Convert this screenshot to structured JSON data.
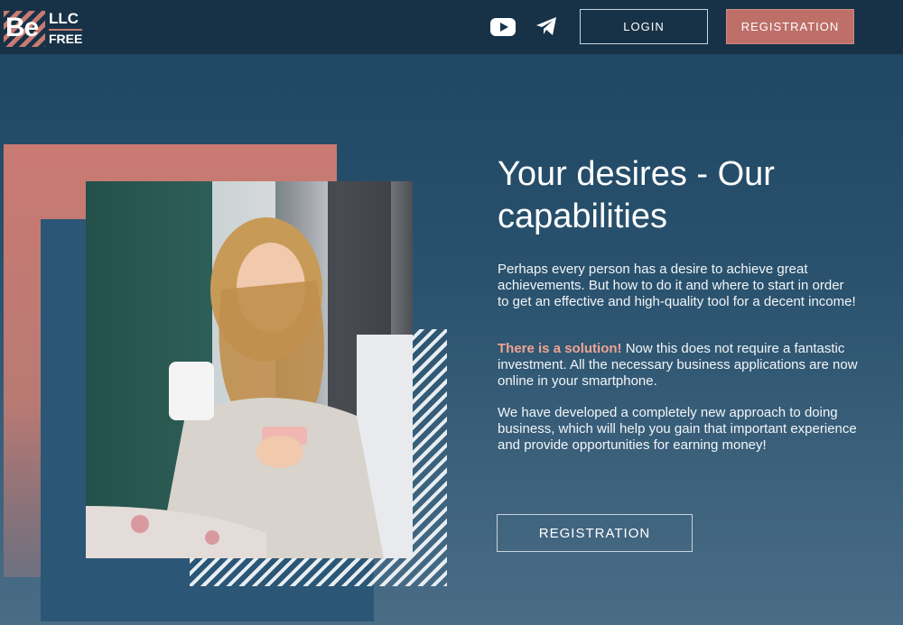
{
  "header": {
    "logo": {
      "main": "Be",
      "top": "LLC",
      "bottom": "FREE"
    },
    "icons": [
      "youtube-icon",
      "telegram-icon"
    ],
    "login_label": "LOGIN",
    "registration_label": "REGISTRATION"
  },
  "hero": {
    "title": "Your desires - Our capabilities",
    "paragraph1": "Perhaps every person has a desire to achieve great achievements. But how to do it and where to start in order to get an effective and high-quality tool for a decent income!",
    "paragraph2_highlight": "There is a solution!",
    "paragraph2_rest": " Now this does not require a fantastic investment. All the necessary business applications are now online in your smartphone.",
    "paragraph3": "We have developed a completely new approach to doing business, which will help you gain that important experience and provide opportunities for earning money!",
    "registration_label": "REGISTRATION"
  },
  "colors": {
    "accent": "#bd6f68",
    "header_bg": "#173247",
    "panel_blue": "#2c5675",
    "highlight_text": "#f0a394"
  }
}
